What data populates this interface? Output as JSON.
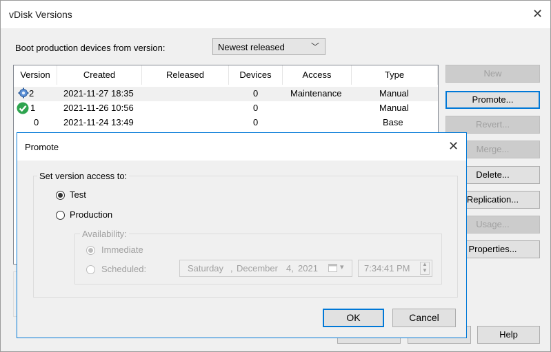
{
  "window": {
    "title": "vDisk Versions"
  },
  "boot": {
    "label": "Boot production devices from version:",
    "selected": "Newest released"
  },
  "table": {
    "columns": [
      "Version",
      "Created",
      "Released",
      "Devices",
      "Access",
      "Type"
    ],
    "rows": [
      {
        "version": "2",
        "created": "2021-11-27 18:35",
        "released": "",
        "devices": "0",
        "access": "Maintenance",
        "type": "Manual",
        "icon": "gear-icon"
      },
      {
        "version": "1",
        "created": "2021-11-26 10:56",
        "released": "",
        "devices": "0",
        "access": "",
        "type": "Manual",
        "icon": "green-check-icon"
      },
      {
        "version": "0",
        "created": "2021-11-24 13:49",
        "released": "",
        "devices": "0",
        "access": "",
        "type": "Base",
        "icon": ""
      }
    ]
  },
  "side_buttons": {
    "new": "New",
    "promote": "Promote...",
    "revert": "Revert...",
    "merge": "Merge...",
    "delete": "Delete...",
    "replication": "Replication...",
    "usage": "Usage...",
    "properties": "Properties...",
    "help": "Help"
  },
  "dialog": {
    "title": "Promote",
    "group_label": "Set version access to:",
    "option_test": "Test",
    "option_production": "Production",
    "selected": "Test",
    "availability_label": "Availability:",
    "option_immediate": "Immediate",
    "option_scheduled": "Scheduled:",
    "availability_selected": "Immediate",
    "date": {
      "day": "Saturday",
      "month": "December",
      "daynum": "4,",
      "year": "2021"
    },
    "time": "7:34:41 PM",
    "ok": "OK",
    "cancel": "Cancel"
  },
  "colors": {
    "accent": "#0078d7",
    "disabled_text": "#a0a0a0"
  }
}
